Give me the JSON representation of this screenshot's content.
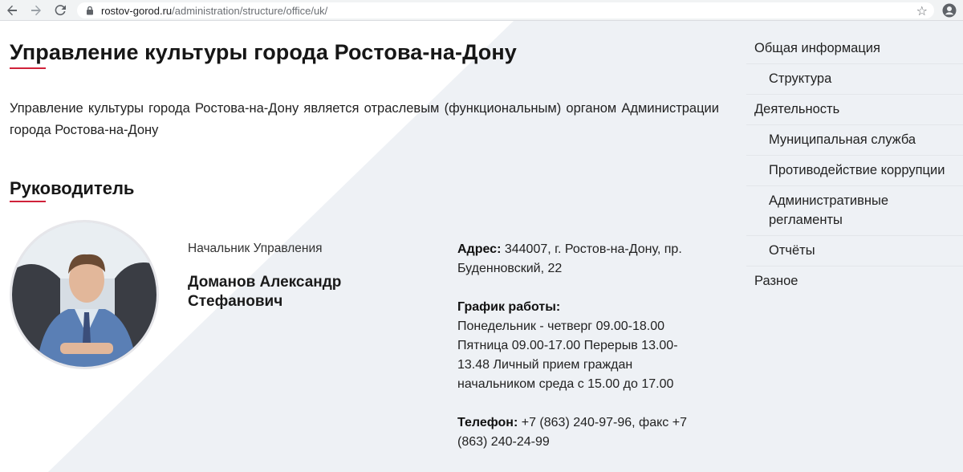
{
  "browser": {
    "url_domain": "rostov-gorod.ru",
    "url_path": "/administration/structure/office/uk/",
    "star_icon": "star-icon",
    "account_icon": "account-icon"
  },
  "page": {
    "title": "Управление культуры города Ростова-на-Дону",
    "intro": "Управление культуры города Ростова-на-Дону является отраслевым (функциональным) органом Администрации города Ростова-на-Дону",
    "section_title": "Руководитель",
    "head": {
      "position": "Начальник Управления",
      "name": "Доманов Александр Стефанович"
    },
    "contacts": {
      "address_label": "Адрес:",
      "address_value": "344007, г. Ростов-на-Дону, пр. Буденновский, 22",
      "schedule_label": "График работы:",
      "schedule_value": "Понедельник - четверг 09.00-18.00 Пятница 09.00-17.00 Перерыв 13.00-13.48 Личный прием граждан начальником среда с 15.00 до 17.00",
      "phone_label": "Телефон:",
      "phone_value": "+7 (863) 240-97-96, факс +7 (863) 240-24-99"
    },
    "accent_color": "#d0223a"
  },
  "side_menu": {
    "items": [
      {
        "label": "Общая информация",
        "level": 0
      },
      {
        "label": "Структура",
        "level": 1
      },
      {
        "label": "Деятельность",
        "level": 0
      },
      {
        "label": "Муниципальная служба",
        "level": 1
      },
      {
        "label": "Противодействие коррупции",
        "level": 1
      },
      {
        "label": "Административные регламенты",
        "level": 1
      },
      {
        "label": "Отчёты",
        "level": 1
      },
      {
        "label": "Разное",
        "level": 0
      }
    ]
  }
}
